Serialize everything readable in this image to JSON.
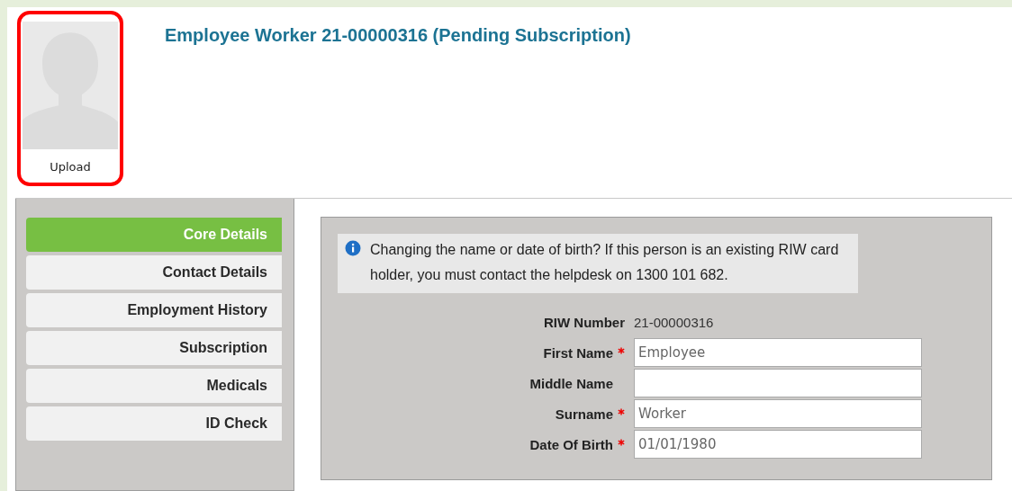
{
  "profile": {
    "upload_label": "Upload",
    "title": "Employee Worker 21-00000316 (Pending Subscription)"
  },
  "nav": [
    {
      "label": "Core Details",
      "selected": true
    },
    {
      "label": "Contact Details",
      "selected": false
    },
    {
      "label": "Employment History",
      "selected": false
    },
    {
      "label": "Subscription",
      "selected": false
    },
    {
      "label": "Medicals",
      "selected": false
    },
    {
      "label": "ID Check",
      "selected": false
    }
  ],
  "notice": "Changing the name or date of birth? If this person is an existing RIW card holder, you must contact the helpdesk on 1300 101 682.",
  "form": {
    "riw_label": "RIW Number",
    "riw_value": "21-00000316",
    "fields": [
      {
        "label": "First Name",
        "required": true,
        "value": "Employee"
      },
      {
        "label": "Middle Name",
        "required": false
      },
      {
        "label": "Surname",
        "required": true,
        "value": "Worker"
      },
      {
        "label": "Date Of Birth",
        "required": true,
        "value": "01/01/1980"
      }
    ]
  }
}
